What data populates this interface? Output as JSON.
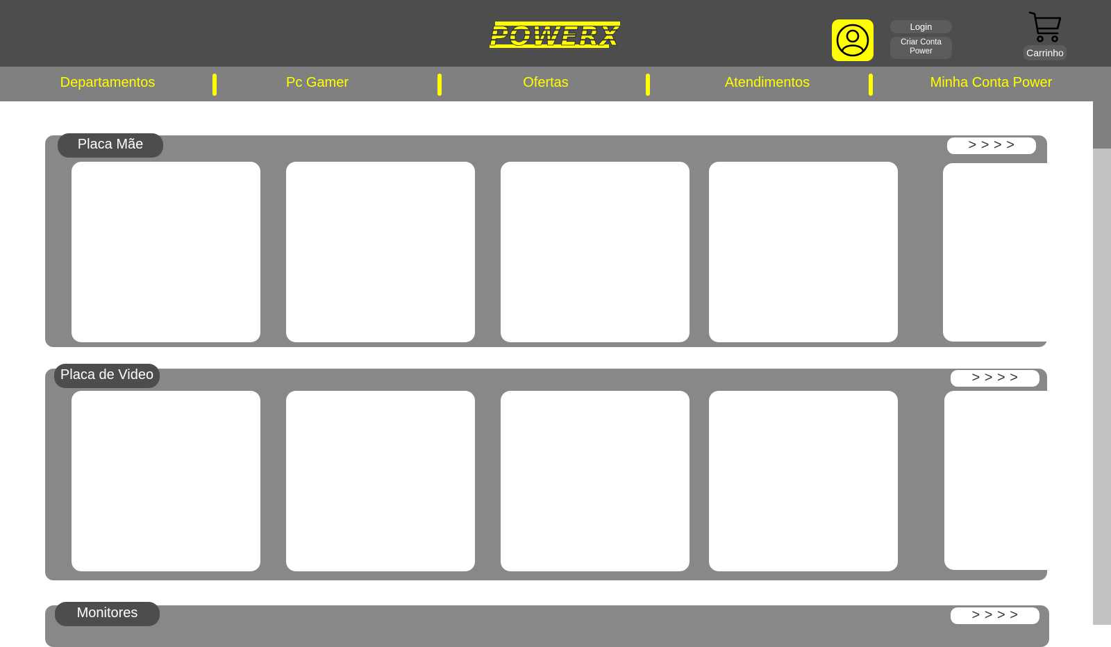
{
  "header": {
    "logo_text": "POWERX",
    "login_label": "Login",
    "create_account_line1": "Criar Conta",
    "create_account_line2": "Power",
    "cart_label": "Carrinho",
    "profile_icon": "user-circle-icon",
    "cart_icon": "shopping-cart-icon"
  },
  "nav": {
    "items": [
      {
        "label": "Departamentos"
      },
      {
        "label": "Pc Gamer"
      },
      {
        "label": "Ofertas"
      },
      {
        "label": "Atendimentos"
      },
      {
        "label": "Minha Conta Power"
      }
    ]
  },
  "sections": [
    {
      "title": "Placa Mãe",
      "more_label": "> > > >",
      "cards_visible": 5
    },
    {
      "title": "Placa de Video",
      "more_label": "> > > >",
      "cards_visible": 5
    },
    {
      "title": "Monitores",
      "more_label": "> > > >",
      "cards_visible": 0
    }
  ],
  "colors": {
    "header_bg": "#4d4d4d",
    "nav_bg": "#808080",
    "accent_yellow": "#ffff00",
    "section_bg": "#888888",
    "title_pill_bg": "#4d4d4d",
    "card_bg": "#ffffff"
  }
}
